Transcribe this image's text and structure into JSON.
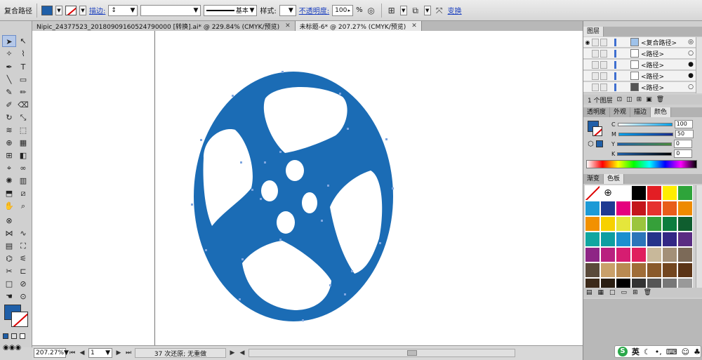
{
  "control_bar": {
    "object_type": "复合路径",
    "stroke_label": "描边:",
    "stroke_profile": "基本",
    "style_label": "样式:",
    "opacity_label": "不透明度:",
    "opacity_value": "100",
    "opacity_unit": "%",
    "transform_label": "变换",
    "fill_color": "#1f5fa8"
  },
  "tabs": [
    {
      "label": "Nipic_24377523_20180909160524790000 [转换].ai* @ 229.84% (CMYK/预览)",
      "active": false
    },
    {
      "label": "未标题-6* @ 207.27% (CMYK/预览)",
      "active": true
    }
  ],
  "status_bar": {
    "zoom": "207.27%",
    "page": "1",
    "undo_info": "37 次还原; 无重做"
  },
  "layers_panel": {
    "tab_label": "图层",
    "rows": [
      {
        "name": "<复合路径>",
        "target": "◎"
      },
      {
        "name": "<路径>",
        "target": "○"
      },
      {
        "name": "<路径>",
        "target": "●"
      },
      {
        "name": "<路径>",
        "target": "●"
      },
      {
        "name": "<路径>",
        "target": "○"
      }
    ],
    "footer": "1 个图层"
  },
  "color_panel": {
    "tabs": [
      "透明度",
      "外观",
      "描边",
      "颜色"
    ],
    "channels": [
      {
        "name": "C",
        "value": "100"
      },
      {
        "name": "M",
        "value": "50"
      },
      {
        "name": "Y",
        "value": "0"
      },
      {
        "name": "K",
        "value": "0"
      }
    ]
  },
  "swatches_panel": {
    "tabs": [
      "渐变",
      "色板"
    ],
    "colors": [
      "#ffffff",
      "#ffffff",
      "#ffffff",
      "#000000",
      "#e31e24",
      "#ffed00",
      "#2ea43a",
      "#1d9ad6",
      "#1f3a93",
      "#e5007e",
      "#c4161c",
      "#e6312e",
      "#e85d1a",
      "#ee8a00",
      "#f29100",
      "#f7d100",
      "#e5e63b",
      "#9bc53d",
      "#36a03a",
      "#0b7d3e",
      "#0f5e2f",
      "#0fa6a0",
      "#0e9ea1",
      "#1b8fcf",
      "#2c75b9",
      "#25338a",
      "#322785",
      "#5a2c82",
      "#8e2585",
      "#b9207f",
      "#d61d71",
      "#e01f5e",
      "#c8b89a",
      "#a39078",
      "#7c6a58",
      "#5a4a3a",
      "#c9a06a",
      "#b98a52",
      "#a06d38",
      "#8a5a2b",
      "#73461f",
      "#5b3416",
      "#3c2a1a",
      "#2a1e12",
      "#000000",
      "#333333",
      "#555555",
      "#777777",
      "#999999"
    ]
  },
  "ime_bar": {
    "label": "英"
  }
}
